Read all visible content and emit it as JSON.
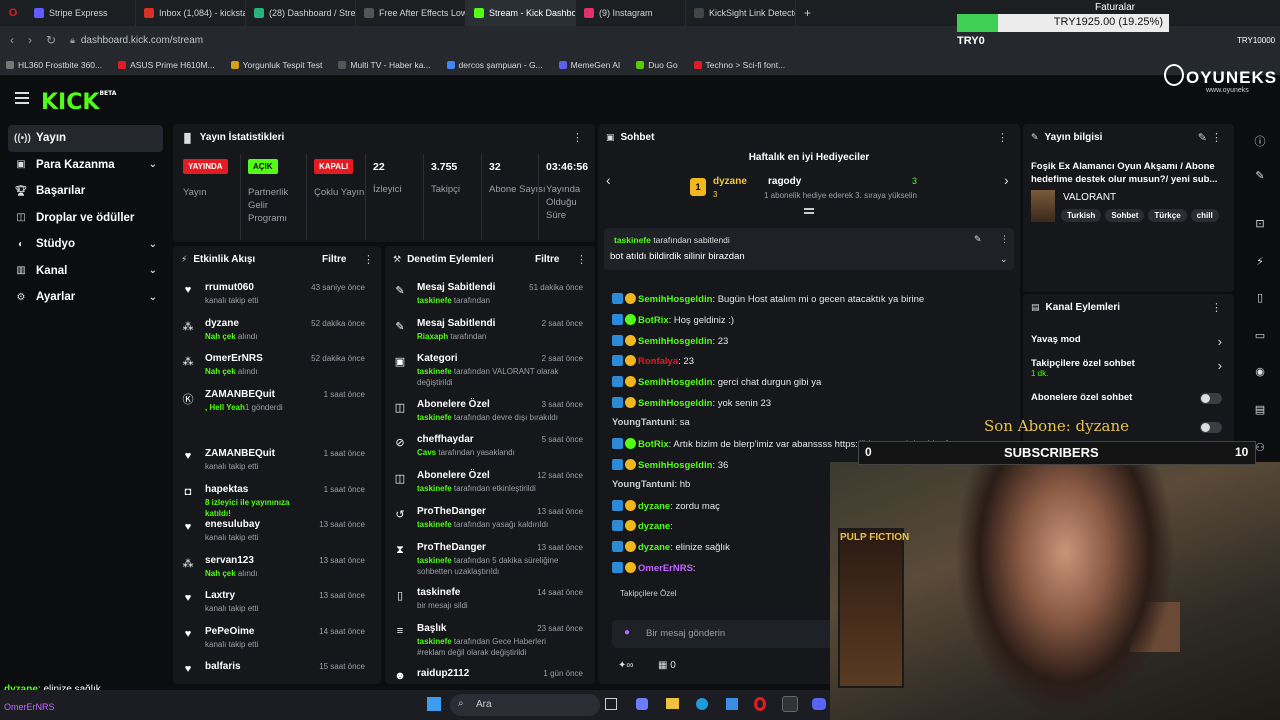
{
  "browser": {
    "tabs": [
      {
        "label": "Stripe Express",
        "color": "#635bff",
        "active": false
      },
      {
        "label": "Inbox (1,084) - kickstaste",
        "color": "#d93025",
        "active": false
      },
      {
        "label": "(28) Dashboard / Streamla",
        "color": "#2ab27b",
        "active": false
      },
      {
        "label": "Free After Effects Lower T",
        "color": "#555555",
        "active": false
      },
      {
        "label": "Stream - Kick Dashboard",
        "color": "#53fc18",
        "active": true
      },
      {
        "label": "(9) Instagram",
        "color": "#e1306c",
        "active": false
      },
      {
        "label": "KickSight Link Detector",
        "color": "#444444",
        "active": false
      }
    ],
    "url": "dashboard.kick.com/stream",
    "bookmarks": [
      "HL360 Frostbite 360...",
      "ASUS Prime H610M...",
      "Yorgunluk Tespit Test",
      "Multi TV - Haber ka...",
      "dercos şampuan - G...",
      "MemeGen AI",
      "Duo Go",
      "Techno > Sci-fi font..."
    ]
  },
  "donation_overlay": {
    "title": "Faturalar",
    "amount": "TRY1925.00 (19.25%)",
    "progress": 0.1925,
    "left_label": "TRY0",
    "right_label": "TRY10000"
  },
  "brand": {
    "logo": "KICK",
    "beta": "BETA",
    "overlay_logo": "OYUNEKS",
    "overlay_sub": "www.oyuneks"
  },
  "sidebar": {
    "items": [
      {
        "label": "Yayın",
        "icon": "broadcast-icon",
        "chevron": false
      },
      {
        "label": "Para Kazanma",
        "icon": "wallet-icon",
        "chevron": true
      },
      {
        "label": "Başarılar",
        "icon": "trophy-icon",
        "chevron": false
      },
      {
        "label": "Droplar ve ödüller",
        "icon": "gift-icon",
        "chevron": false
      },
      {
        "label": "Stüdyo",
        "icon": "studio-icon",
        "chevron": true
      },
      {
        "label": "Kanal",
        "icon": "channel-icon",
        "chevron": true
      },
      {
        "label": "Ayarlar",
        "icon": "gear-icon",
        "chevron": true
      }
    ]
  },
  "stats": {
    "title": "Yayın İstatistikleri",
    "items": [
      {
        "badge": "YAYINDA",
        "label": "Yayın"
      },
      {
        "badge": "AÇIK",
        "label": "Partnerlik Gelir Programı"
      },
      {
        "badge": "KAPALI",
        "label": "Çoklu Yayın"
      },
      {
        "value": "22",
        "label": "İzleyici"
      },
      {
        "value": "3.755",
        "label": "Takipçi"
      },
      {
        "value": "32",
        "label": "Abone Sayısı"
      },
      {
        "value": "03:46:56",
        "label": "Yayında Olduğu Süre"
      }
    ]
  },
  "activity": {
    "title": "Etkinlik Akışı",
    "filter": "Filtre",
    "items": [
      {
        "icon": "heart-icon",
        "name": "rrumut060",
        "sub": "kanalı takip etti",
        "time": "43 saniye önce"
      },
      {
        "icon": "sub-icon",
        "name": "dyzane",
        "hl": "Nah çek",
        "sub": " alındı",
        "time": "52 dakika önce"
      },
      {
        "icon": "sub-icon",
        "name": "OmerErNRS",
        "hl": "Nah çek",
        "sub": " alındı",
        "time": "52 dakika önce"
      },
      {
        "icon": "kick-icon",
        "name": "ZAMANBEQuit",
        "hl": ", Hell Yeah",
        "sub": "1 gönderdi",
        "time": "1 saat önce"
      },
      {
        "icon": "heart-icon",
        "name": "ZAMANBEQuit",
        "sub": "kanalı takip etti",
        "time": "1 saat önce"
      },
      {
        "icon": "host-icon",
        "name": "hapektas",
        "hl": "8 izleyici ile yayınınıza katıldı!",
        "sub": "",
        "time": "1 saat önce"
      },
      {
        "icon": "heart-icon",
        "name": "enesulubay",
        "sub": "kanalı takip etti",
        "time": "13 saat önce"
      },
      {
        "icon": "sub-icon",
        "name": "servan123",
        "hl": "Nah çek",
        "sub": " alındı",
        "time": "13 saat önce"
      },
      {
        "icon": "heart-icon",
        "name": "Laxtry",
        "sub": "kanalı takip etti",
        "time": "13 saat önce"
      },
      {
        "icon": "heart-icon",
        "name": "PePeOime",
        "sub": "kanalı takip etti",
        "time": "14 saat önce"
      },
      {
        "icon": "heart-icon",
        "name": "balfaris",
        "sub": "",
        "time": "15 saat önce"
      }
    ]
  },
  "moderation": {
    "title": "Denetim Eylemleri",
    "filter": "Filtre",
    "items": [
      {
        "icon": "pin-icon",
        "name": "Mesaj Sabitlendi",
        "hl": "taskinefe",
        "sub": " tarafından",
        "time": "51 dakika önce"
      },
      {
        "icon": "pin-icon",
        "name": "Mesaj Sabitlendi",
        "hl": "Riaxaph",
        "sub": " tarafından",
        "time": "2 saat önce"
      },
      {
        "icon": "category-icon",
        "name": "Kategori",
        "hl": "taskinefe",
        "sub": " tarafından VALORANT olarak değiştirildi",
        "time": "2 saat önce"
      },
      {
        "icon": "gift-icon",
        "name": "Abonelere Özel",
        "hl": "taskinefe",
        "sub": " tarafından devre dışı bırakıldı",
        "time": "3 saat önce"
      },
      {
        "icon": "ban-icon",
        "name": "cheffhaydar",
        "hl": "Cavs",
        "sub": " tarafından yasaklandı",
        "time": "5 saat önce"
      },
      {
        "icon": "gift-icon",
        "name": "Abonelere Özel",
        "hl": "taskinefe",
        "sub": " tarafından etkinleştirildi",
        "time": "12 saat önce"
      },
      {
        "icon": "unban-icon",
        "name": "ProTheDanger",
        "hl": "taskinefe",
        "sub": " tarafından yasağı kaldırıldı",
        "time": "13 saat önce"
      },
      {
        "icon": "timeout-icon",
        "name": "ProTheDanger",
        "hl": "taskinefe",
        "sub": " tarafından 5 dakika süreliğine sohbetten uzaklaştırıldı",
        "time": "13 saat önce"
      },
      {
        "icon": "trash-icon",
        "name": "taskinefe",
        "hl": "",
        "sub": "bir mesajı sildi",
        "time": "14 saat önce"
      },
      {
        "icon": "title-icon",
        "name": "Başlık",
        "hl": "taskinefe",
        "sub": " tarafından Gece Haberleri #reklam değil olarak değiştirildi",
        "time": "23 saat önce"
      },
      {
        "icon": "user-icon",
        "name": "raidup2112",
        "hl": "",
        "sub": "",
        "time": "1 gün önce"
      }
    ]
  },
  "chat": {
    "title": "Sohbet",
    "leaderboard_title": "Haftalık en iyi Hediyeciler",
    "top1": {
      "name": "dyzane",
      "count": "3"
    },
    "top2": {
      "name": "ragody",
      "count": "3"
    },
    "top_note": "1 abonelik hediye ederek 3. sıraya yükselin",
    "pinned_by": "taskinefe",
    "pinned_suffix": "tarafından sabitlendi",
    "pinned_msg": "bot atıldı bildirdik silinir birazdan",
    "messages": [
      {
        "user": "SemihHosgeldin",
        "text": "Bugün Host atalım mi o gecen atacaktık ya birine",
        "color": "#53fc18"
      },
      {
        "user": "BotRix",
        "text": "Hoş geldiniz :)",
        "color": "#53fc18"
      },
      {
        "user": "SemihHosgeldin",
        "text": "23",
        "color": "#53fc18"
      },
      {
        "user": "Ronfalya",
        "text": "23",
        "color": "#e31b23"
      },
      {
        "user": "SemihHosgeldin",
        "text": "gerci chat durgun gibi ya",
        "color": "#53fc18"
      },
      {
        "user": "SemihHosgeldin",
        "text": "yok senin 23",
        "color": "#53fc18"
      },
      {
        "user": "YoungTantuni",
        "text": "sa",
        "color": "#cccccc"
      },
      {
        "user": "BotRix",
        "text": "Artık bizim de blerp'imiz var abanssss https://blerp.com/x/taskinefe",
        "color": "#53fc18"
      },
      {
        "user": "SemihHosgeldin",
        "text": "36",
        "color": "#53fc18"
      },
      {
        "user": "YoungTantuni",
        "text": "hb",
        "color": "#cccccc"
      },
      {
        "user": "dyzane",
        "text": "zordu maç",
        "color": "#53fc18"
      },
      {
        "user": "dyzane",
        "text": "",
        "color": "#53fc18"
      },
      {
        "user": "dyzane",
        "text": "elinize sağlık",
        "color": "#53fc18"
      },
      {
        "user": "OmerErNRS",
        "text": "",
        "color": "#c165ff"
      }
    ],
    "followers_only": "Takipçilere Özel",
    "input_placeholder": "Bir mesaj gönderin",
    "footer_count": "0"
  },
  "stream_info": {
    "title": "Yayın bilgisi",
    "stream_title": "Foşik Ex Alamancı Oyun Akşamı / Abone hedefime destek olur musun?/ yeni sub...",
    "category": "VALORANT",
    "tags": [
      "Turkish",
      "Sohbet",
      "Türkçe",
      "chill"
    ]
  },
  "channel_actions": {
    "title": "Kanal Eylemleri",
    "rows": [
      {
        "label": "Yavaş mod",
        "sub": "",
        "type": "arrow"
      },
      {
        "label": "Takipçilere özel sohbet",
        "sub": "1 dk.",
        "type": "arrow"
      },
      {
        "label": "Abonelere özel sohbet",
        "sub": "",
        "type": "toggle"
      },
      {
        "label": "sohbet",
        "sub": "",
        "type": "toggle"
      },
      {
        "label": "Sohbet Denetimi",
        "sub": "",
        "type": "link"
      }
    ]
  },
  "overlay": {
    "last_sub_label": "Son Abone: dyzane",
    "subs_left": "0",
    "subs_title": "SUBSCRIBERS",
    "subs_right": "10",
    "bottom_chat_user": "dyzane",
    "bottom_chat_text": "elinize sağlık",
    "bottom_chat_user2": "OmerErNRS"
  },
  "taskbar": {
    "search": "Ara"
  }
}
